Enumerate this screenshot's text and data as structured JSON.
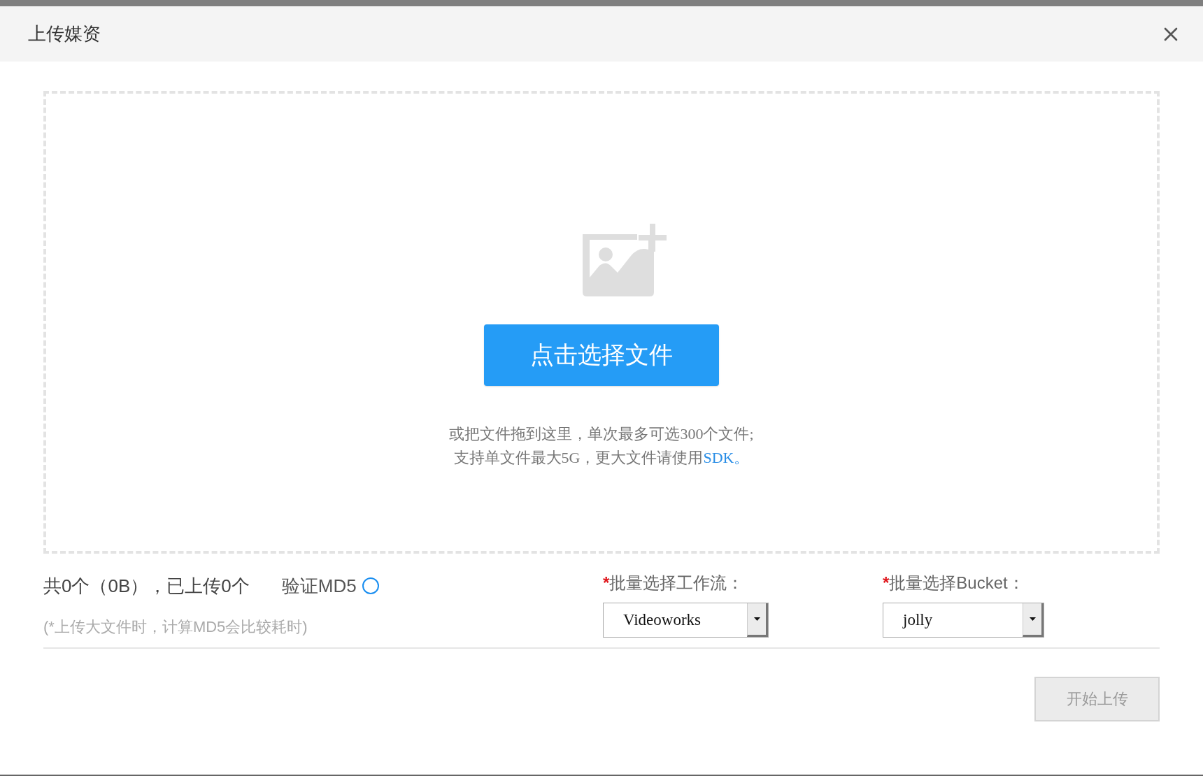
{
  "dialog": {
    "title": "上传媒资"
  },
  "upload": {
    "button": "点击选择文件",
    "hint_line_1": "或把文件拖到这里，单次最多可选300个文件;",
    "hint_line_2": "支持单文件最大5G，更大文件请使用",
    "link": "SDK。"
  },
  "summary": {
    "text": "共0个（0B），已上传0个",
    "verify_md5": {
      "label": "验证MD5",
      "checked": false
    },
    "note": "(*上传大文件时，计算MD5会比较耗时)"
  },
  "fields": [
    {
      "required_mark": "*",
      "label": "批量选择工作流：",
      "value": "Videoworks"
    },
    {
      "required_mark": "*",
      "label": "批量选择Bucket：",
      "value": "jolly"
    }
  ],
  "start_button": {
    "label": "开始上传",
    "disabled": true
  }
}
